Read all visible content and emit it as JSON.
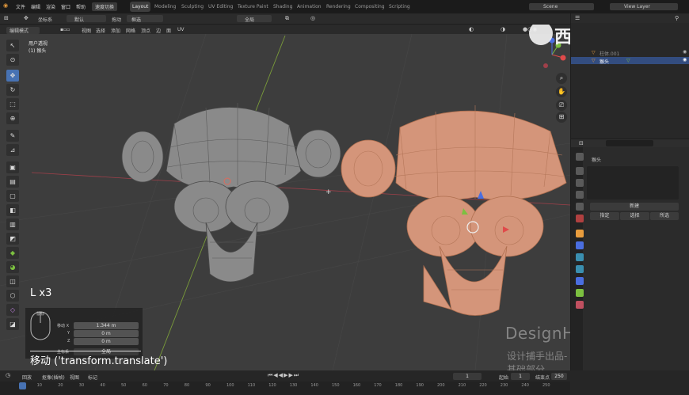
{
  "topbar": {
    "menus": [
      "文件",
      "编辑",
      "渲染",
      "窗口",
      "帮助"
    ],
    "mode_switch": "速度切换",
    "workspaces": [
      "Layout",
      "Modeling",
      "Sculpting",
      "UV Editing",
      "Texture Paint",
      "Shading",
      "Animation",
      "Rendering",
      "Compositing",
      "Scripting"
    ],
    "active_workspace": "Layout",
    "scene": "Scene",
    "view_layer": "View Layer"
  },
  "header": {
    "orientation": "坐标系",
    "orientation_value": "默认",
    "drag_label": "拖动",
    "drag_value": "框选",
    "pivot": "全局"
  },
  "header2": {
    "mode": "编辑模式",
    "menus": [
      "视图",
      "选择",
      "添加",
      "网格",
      "顶点",
      "边",
      "面",
      "UV"
    ]
  },
  "viewport": {
    "view_name": "用户透视",
    "object_name": "(1) 猴头",
    "key_hint": "L x3",
    "watermark_logo": "西瓜视频",
    "watermark_brand": "DesignHunting",
    "watermark_sub": "设计捕手出品-基础部分",
    "left_mesh_color": "#8a8a8a",
    "right_mesh_color": "#d4957a"
  },
  "operator_panel": {
    "mouse_label": "鼠标",
    "rows": [
      {
        "axis": "移动 X",
        "value": "1.344 m"
      },
      {
        "axis": "Y",
        "value": "0 m"
      },
      {
        "axis": "Z",
        "value": "0 m"
      }
    ],
    "orient_label": "坐标系",
    "orient_value": "全局",
    "operator": "移动 ('transform.translate')"
  },
  "outliner": {
    "items": [
      {
        "name": "柱体.001",
        "selected": false
      },
      {
        "name": "猴头",
        "selected": true
      }
    ]
  },
  "properties": {
    "object_name": "猴头",
    "new_button": "新建",
    "assign": "指定",
    "select": "选择",
    "deselect": "所选"
  },
  "timeline": {
    "menus": [
      "回放",
      "抠像(插帧)",
      "视图",
      "标记"
    ],
    "current_frame": "1",
    "start_label": "起始",
    "start": "1",
    "end_label": "结束点",
    "end": "250",
    "ticks": [
      "1",
      "10",
      "20",
      "30",
      "40",
      "50",
      "60",
      "70",
      "80",
      "90",
      "100",
      "110",
      "120",
      "130",
      "140",
      "150",
      "160",
      "170",
      "180",
      "190",
      "200",
      "210",
      "220",
      "230",
      "240",
      "250"
    ]
  }
}
